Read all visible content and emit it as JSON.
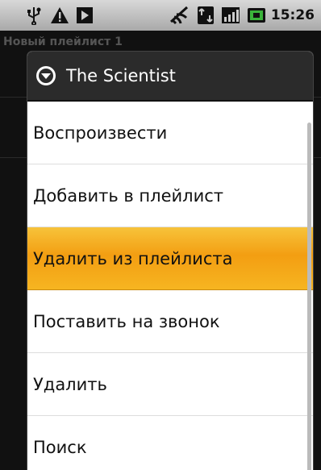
{
  "status_bar": {
    "time": "15:26",
    "icons": [
      "usb-icon",
      "warning-icon",
      "play-icon",
      "wifi-icon",
      "data-icon",
      "signal-icon",
      "battery-icon"
    ]
  },
  "background_app": {
    "title": "Новый плейлист 1"
  },
  "dialog": {
    "title": "The Scientist",
    "items": [
      {
        "label": "Воспроизвести"
      },
      {
        "label": "Добавить в плейлист"
      },
      {
        "label": "Удалить из плейлиста",
        "selected": true
      },
      {
        "label": "Поставить на звонок"
      },
      {
        "label": "Удалить"
      },
      {
        "label": "Поиск"
      }
    ]
  },
  "colors": {
    "highlight": "#f5ad1e",
    "header": "#2b2b2b"
  }
}
